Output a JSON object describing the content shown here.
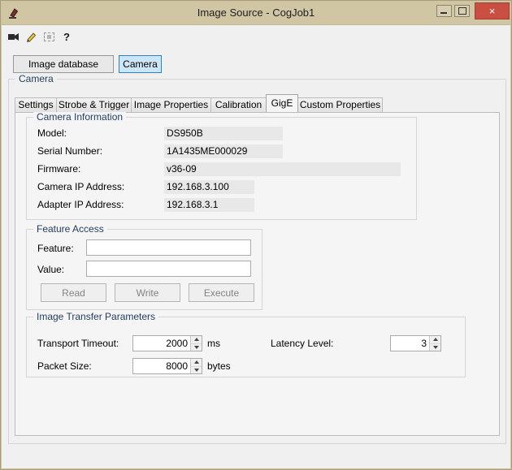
{
  "window": {
    "title": "Image Source - CogJob1",
    "close_glyph": "×"
  },
  "toolbar": {
    "icons": [
      {
        "name": "camera-acquire-icon"
      },
      {
        "name": "setup-pen-icon"
      },
      {
        "name": "live-display-icon"
      },
      {
        "name": "help-icon",
        "glyph": "?"
      }
    ]
  },
  "source_buttons": {
    "image_database": "Image database",
    "camera": "Camera"
  },
  "camera": {
    "group_label": "Camera",
    "tabs": [
      "Settings",
      "Strobe & Trigger",
      "Image Properties",
      "Calibration",
      "GigE",
      "Custom Properties"
    ],
    "active_tab": "GigE",
    "camera_information": {
      "label": "Camera Information",
      "fields": [
        {
          "label": "Model:",
          "value": "DS950B"
        },
        {
          "label": "Serial Number:",
          "value": "1A1435ME000029"
        },
        {
          "label": "Firmware:",
          "value": "v36-09"
        },
        {
          "label": "Camera IP Address:",
          "value": "192.168.3.100"
        },
        {
          "label": "Adapter IP Address:",
          "value": "192.168.3.1"
        }
      ]
    },
    "feature_access": {
      "label": "Feature Access",
      "feature_label": "Feature:",
      "feature_value": "",
      "value_label": "Value:",
      "value_value": "",
      "buttons": [
        "Read",
        "Write",
        "Execute"
      ]
    },
    "image_transfer": {
      "label": "Image Transfer Parameters",
      "transport_timeout": {
        "label": "Transport Timeout:",
        "value": "2000",
        "unit": "ms"
      },
      "latency_level": {
        "label": "Latency Level:",
        "value": "3"
      },
      "packet_size": {
        "label": "Packet Size:",
        "value": "8000",
        "unit": "bytes"
      }
    }
  }
}
